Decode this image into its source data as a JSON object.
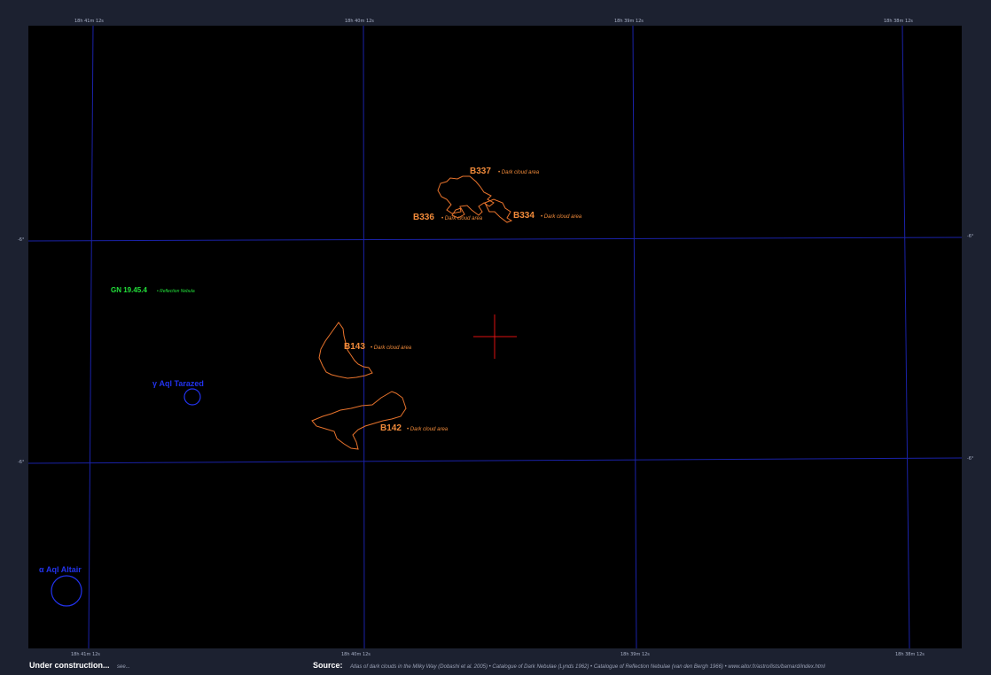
{
  "map": {
    "ra_ticks": [
      "18h 41m 12s",
      "18h 40m 12s",
      "18h 39m 12s",
      "18h 38m 12s"
    ],
    "dec_ticks": [
      "-6°",
      "-6°"
    ],
    "objects": [
      {
        "id": "B337",
        "label": "B337",
        "note": "• Dark cloud area",
        "color": "#f08a3a"
      },
      {
        "id": "B336",
        "label": "B336",
        "note": "• Dark cloud area",
        "color": "#f08a3a"
      },
      {
        "id": "B334",
        "label": "B334",
        "note": "• Dark cloud area",
        "color": "#f08a3a"
      },
      {
        "id": "B143",
        "label": "B143",
        "note": "• Dark cloud area",
        "color": "#f08a3a"
      },
      {
        "id": "B142",
        "label": "B142",
        "note": "• Dark cloud area",
        "color": "#f08a3a"
      },
      {
        "id": "GN",
        "label": "GN 19.45.4",
        "note": "• Reflection Nebula",
        "color": "#22e03a"
      },
      {
        "id": "tamana",
        "label": "γ Aql  Tarazed",
        "color": "#2233ee"
      },
      {
        "id": "altair",
        "label": "α Aql  Altair",
        "color": "#2233ee"
      }
    ]
  },
  "footer": {
    "left_bold": "Under construction...",
    "left_small": "see...",
    "source_label": "Source:",
    "source_text": "Atlas of dark clouds in the Milky Way (Dobashi et al. 2005) • Catalogue of Dark Nebulae (Lynds 1962) • Catalogue of Reflection Nebulae (van den Bergh 1966) • www.aitor.fr/astro/lists/barnard/index.html"
  }
}
